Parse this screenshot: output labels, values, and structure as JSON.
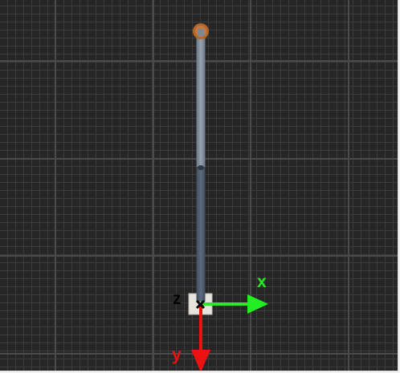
{
  "axes": {
    "x_label": "x",
    "y_label": "y",
    "z_label": "z",
    "x_color": "#22ee22",
    "y_color": "#ee1111",
    "z_color": "#000000"
  },
  "colors": {
    "background": "#262626",
    "grid_minor": "#3c3c3c",
    "grid_major": "#4b4b4b",
    "link_upper": "#7c8896",
    "link_lower": "#4f5e70",
    "base_block": "#e6e4dc",
    "end_effector": "#b3662a",
    "joint": "#2f3a46"
  },
  "icons": {
    "end_effector": "orange-circle-icon",
    "joint": "joint-marker-icon",
    "origin": "origin-cross-icon"
  }
}
